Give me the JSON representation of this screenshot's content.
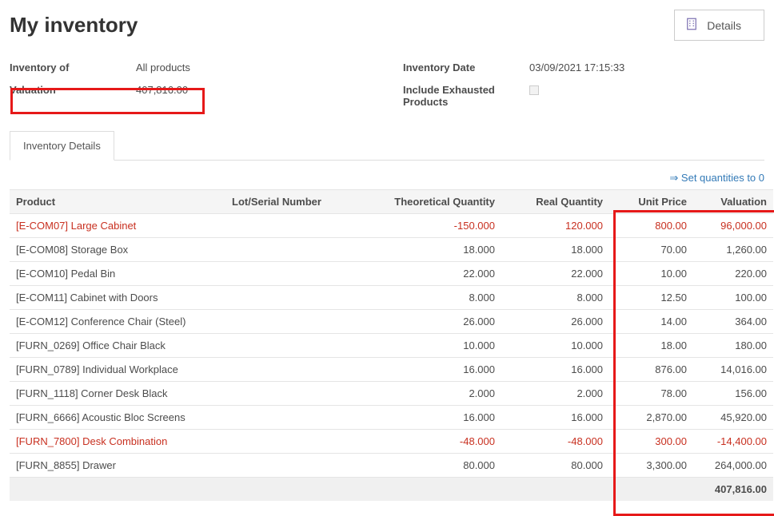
{
  "header": {
    "title": "My inventory",
    "details_label": "Details"
  },
  "form": {
    "left": [
      {
        "label": "Inventory of",
        "value": "All products"
      },
      {
        "label": "Valuation",
        "value": "407,816.00"
      }
    ],
    "right": [
      {
        "label": "Inventory Date",
        "value": "03/09/2021 17:15:33",
        "type": "text"
      },
      {
        "label": "Include Exhausted Products",
        "value": "",
        "type": "checkbox"
      }
    ]
  },
  "tabs": {
    "active": "Inventory Details"
  },
  "actions": {
    "set_zero": "⇒ Set quantities to 0"
  },
  "table": {
    "headers": {
      "product": "Product",
      "lot": "Lot/Serial Number",
      "theo": "Theoretical Quantity",
      "real": "Real Quantity",
      "price": "Unit Price",
      "valuation": "Valuation"
    },
    "rows": [
      {
        "product": "[E-COM07] Large Cabinet",
        "lot": "",
        "theo": "-150.000",
        "real": "120.000",
        "price": "800.00",
        "valuation": "96,000.00",
        "neg": true
      },
      {
        "product": "[E-COM08] Storage Box",
        "lot": "",
        "theo": "18.000",
        "real": "18.000",
        "price": "70.00",
        "valuation": "1,260.00",
        "neg": false
      },
      {
        "product": "[E-COM10] Pedal Bin",
        "lot": "",
        "theo": "22.000",
        "real": "22.000",
        "price": "10.00",
        "valuation": "220.00",
        "neg": false
      },
      {
        "product": "[E-COM11] Cabinet with Doors",
        "lot": "",
        "theo": "8.000",
        "real": "8.000",
        "price": "12.50",
        "valuation": "100.00",
        "neg": false
      },
      {
        "product": "[E-COM12] Conference Chair (Steel)",
        "lot": "",
        "theo": "26.000",
        "real": "26.000",
        "price": "14.00",
        "valuation": "364.00",
        "neg": false
      },
      {
        "product": "[FURN_0269] Office Chair Black",
        "lot": "",
        "theo": "10.000",
        "real": "10.000",
        "price": "18.00",
        "valuation": "180.00",
        "neg": false
      },
      {
        "product": "[FURN_0789] Individual Workplace",
        "lot": "",
        "theo": "16.000",
        "real": "16.000",
        "price": "876.00",
        "valuation": "14,016.00",
        "neg": false
      },
      {
        "product": "[FURN_1118] Corner Desk Black",
        "lot": "",
        "theo": "2.000",
        "real": "2.000",
        "price": "78.00",
        "valuation": "156.00",
        "neg": false
      },
      {
        "product": "[FURN_6666] Acoustic Bloc Screens",
        "lot": "",
        "theo": "16.000",
        "real": "16.000",
        "price": "2,870.00",
        "valuation": "45,920.00",
        "neg": false
      },
      {
        "product": "[FURN_7800] Desk Combination",
        "lot": "",
        "theo": "-48.000",
        "real": "-48.000",
        "price": "300.00",
        "valuation": "-14,400.00",
        "neg": true
      },
      {
        "product": "[FURN_8855] Drawer",
        "lot": "",
        "theo": "80.000",
        "real": "80.000",
        "price": "3,300.00",
        "valuation": "264,000.00",
        "neg": false
      }
    ],
    "footer_total": "407,816.00"
  }
}
